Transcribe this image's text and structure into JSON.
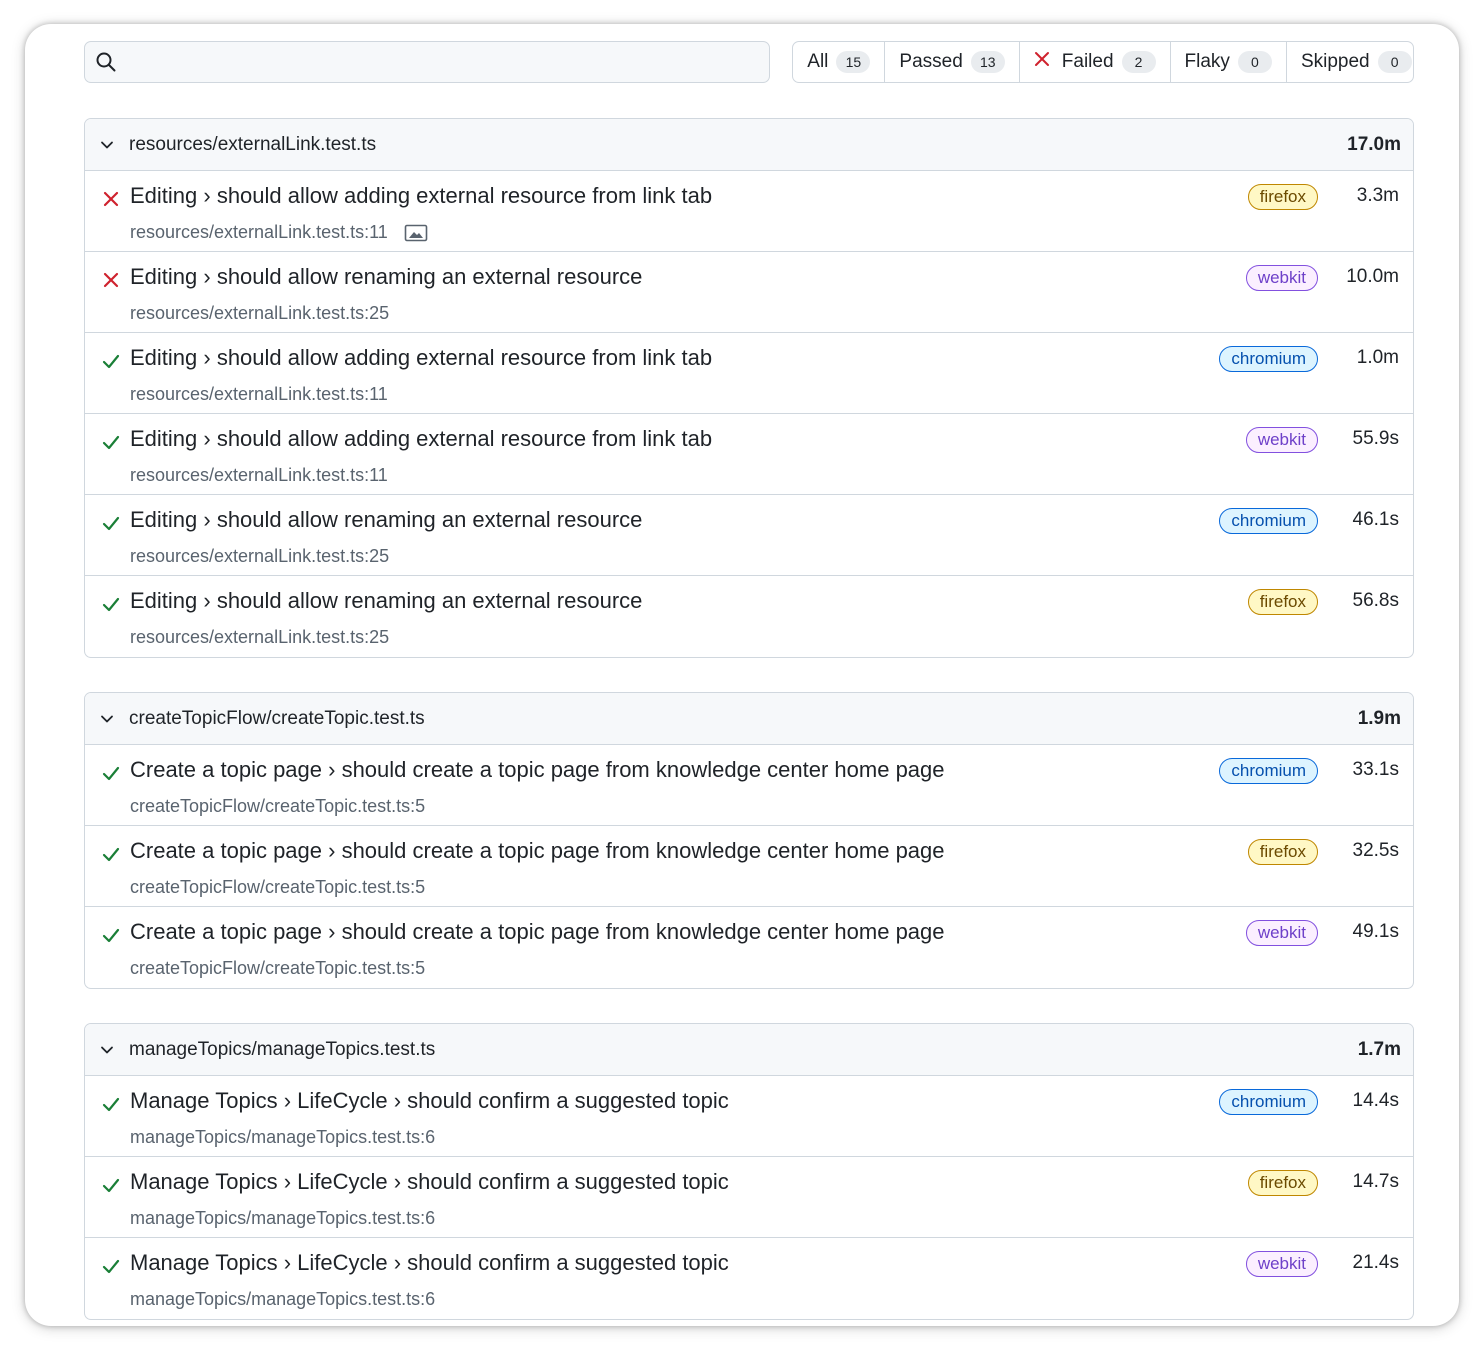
{
  "search": {
    "placeholder": "",
    "value": ""
  },
  "filters": [
    {
      "label": "All",
      "count": "15"
    },
    {
      "label": "Passed",
      "count": "13"
    },
    {
      "label": "Failed",
      "count": "2"
    },
    {
      "label": "Flaky",
      "count": "0"
    },
    {
      "label": "Skipped",
      "count": "0"
    }
  ],
  "colors": {
    "failed": "#cf222e",
    "passed": "#1a7f37"
  },
  "groups": [
    {
      "file": "resources/externalLink.test.ts",
      "duration": "17.0m",
      "tests": [
        {
          "status": "failed",
          "title": "Editing › should allow adding external resource from link tab",
          "location": "resources/externalLink.test.ts:11",
          "has_image": true,
          "browser": "firefox",
          "duration": "3.3m"
        },
        {
          "status": "failed",
          "title": "Editing › should allow renaming an external resource",
          "location": "resources/externalLink.test.ts:25",
          "has_image": false,
          "browser": "webkit",
          "duration": "10.0m"
        },
        {
          "status": "passed",
          "title": "Editing › should allow adding external resource from link tab",
          "location": "resources/externalLink.test.ts:11",
          "has_image": false,
          "browser": "chromium",
          "duration": "1.0m"
        },
        {
          "status": "passed",
          "title": "Editing › should allow adding external resource from link tab",
          "location": "resources/externalLink.test.ts:11",
          "has_image": false,
          "browser": "webkit",
          "duration": "55.9s"
        },
        {
          "status": "passed",
          "title": "Editing › should allow renaming an external resource",
          "location": "resources/externalLink.test.ts:25",
          "has_image": false,
          "browser": "chromium",
          "duration": "46.1s"
        },
        {
          "status": "passed",
          "title": "Editing › should allow renaming an external resource",
          "location": "resources/externalLink.test.ts:25",
          "has_image": false,
          "browser": "firefox",
          "duration": "56.8s"
        }
      ]
    },
    {
      "file": "createTopicFlow/createTopic.test.ts",
      "duration": "1.9m",
      "tests": [
        {
          "status": "passed",
          "title": "Create a topic page › should create a topic page from knowledge center home page",
          "location": "createTopicFlow/createTopic.test.ts:5",
          "has_image": false,
          "browser": "chromium",
          "duration": "33.1s"
        },
        {
          "status": "passed",
          "title": "Create a topic page › should create a topic page from knowledge center home page",
          "location": "createTopicFlow/createTopic.test.ts:5",
          "has_image": false,
          "browser": "firefox",
          "duration": "32.5s"
        },
        {
          "status": "passed",
          "title": "Create a topic page › should create a topic page from knowledge center home page",
          "location": "createTopicFlow/createTopic.test.ts:5",
          "has_image": false,
          "browser": "webkit",
          "duration": "49.1s"
        }
      ]
    },
    {
      "file": "manageTopics/manageTopics.test.ts",
      "duration": "1.7m",
      "tests": [
        {
          "status": "passed",
          "title": "Manage Topics › LifeCycle › should confirm a suggested topic",
          "location": "manageTopics/manageTopics.test.ts:6",
          "has_image": false,
          "browser": "chromium",
          "duration": "14.4s"
        },
        {
          "status": "passed",
          "title": "Manage Topics › LifeCycle › should confirm a suggested topic",
          "location": "manageTopics/manageTopics.test.ts:6",
          "has_image": false,
          "browser": "firefox",
          "duration": "14.7s"
        },
        {
          "status": "passed",
          "title": "Manage Topics › LifeCycle › should confirm a suggested topic",
          "location": "manageTopics/manageTopics.test.ts:6",
          "has_image": false,
          "browser": "webkit",
          "duration": "21.4s"
        }
      ]
    }
  ]
}
